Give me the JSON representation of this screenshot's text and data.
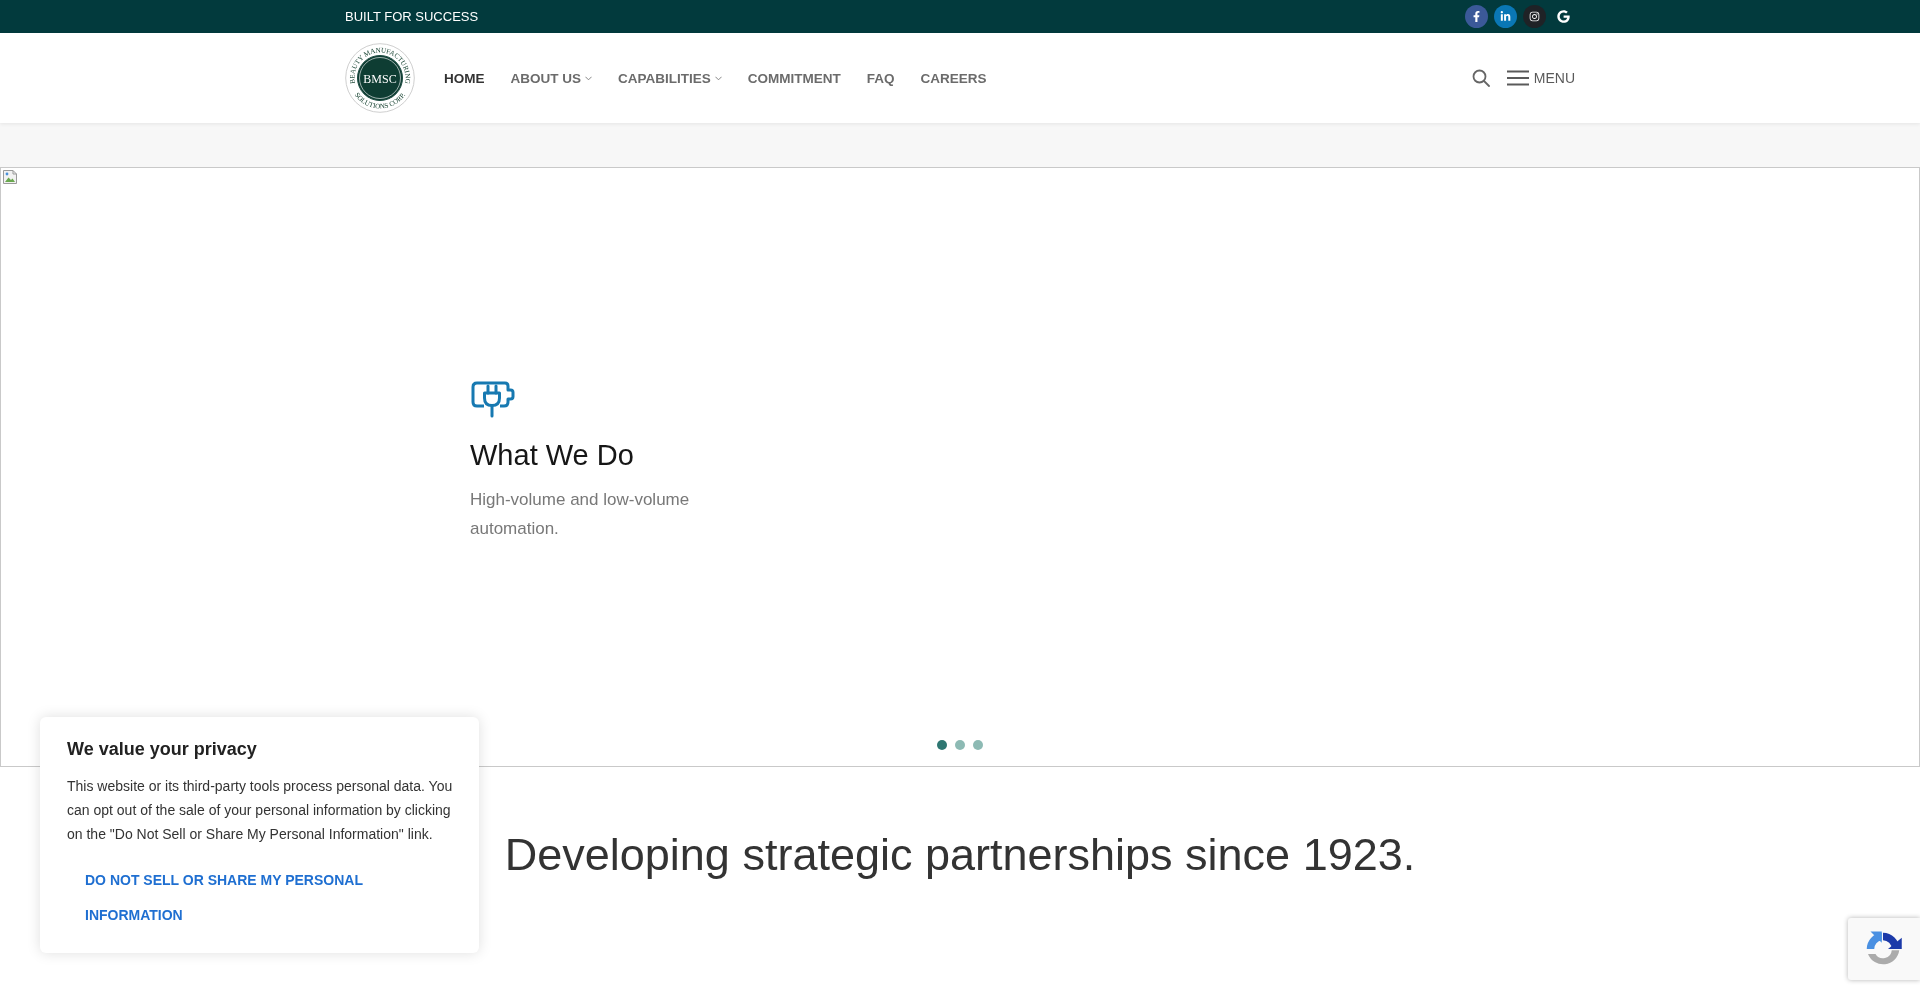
{
  "top_bar": {
    "tagline": "BUILT FOR SUCCESS",
    "social_links": [
      {
        "kind": "facebook"
      },
      {
        "kind": "linkedin"
      },
      {
        "kind": "instagram"
      },
      {
        "kind": "google"
      }
    ]
  },
  "header": {
    "logo": {
      "ring_top": "BEAUTY MANUFACTURING",
      "initials": "BMSC",
      "ring_bottom": "SOLUTIONS CORP."
    },
    "nav": [
      {
        "label": "HOME",
        "selected": true,
        "dropdown": false
      },
      {
        "label": "ABOUT US",
        "selected": false,
        "dropdown": true
      },
      {
        "label": "CAPABILITIES",
        "selected": false,
        "dropdown": true
      },
      {
        "label": "COMMITMENT",
        "selected": false,
        "dropdown": false
      },
      {
        "label": "FAQ",
        "selected": false,
        "dropdown": false
      },
      {
        "label": "CAREERS",
        "selected": false,
        "dropdown": false
      }
    ],
    "menu_button": "MENU"
  },
  "hero": {
    "feature": {
      "title": "What We Do",
      "description": "High-volume and low-volume automation."
    },
    "dots": [
      {
        "selected": true
      },
      {
        "selected": false
      },
      {
        "selected": false
      }
    ]
  },
  "intro": {
    "heading": "Developing strategic partnerships since 1923."
  },
  "cookie_banner": {
    "title": "We value your privacy",
    "body": "This website or its third-party tools process personal data. You can opt out of the sale of your personal information by clicking on the \"Do Not Sell or Share My Personal Information\" link.",
    "link": "DO NOT SELL OR SHARE MY PERSONAL INFORMATION"
  }
}
